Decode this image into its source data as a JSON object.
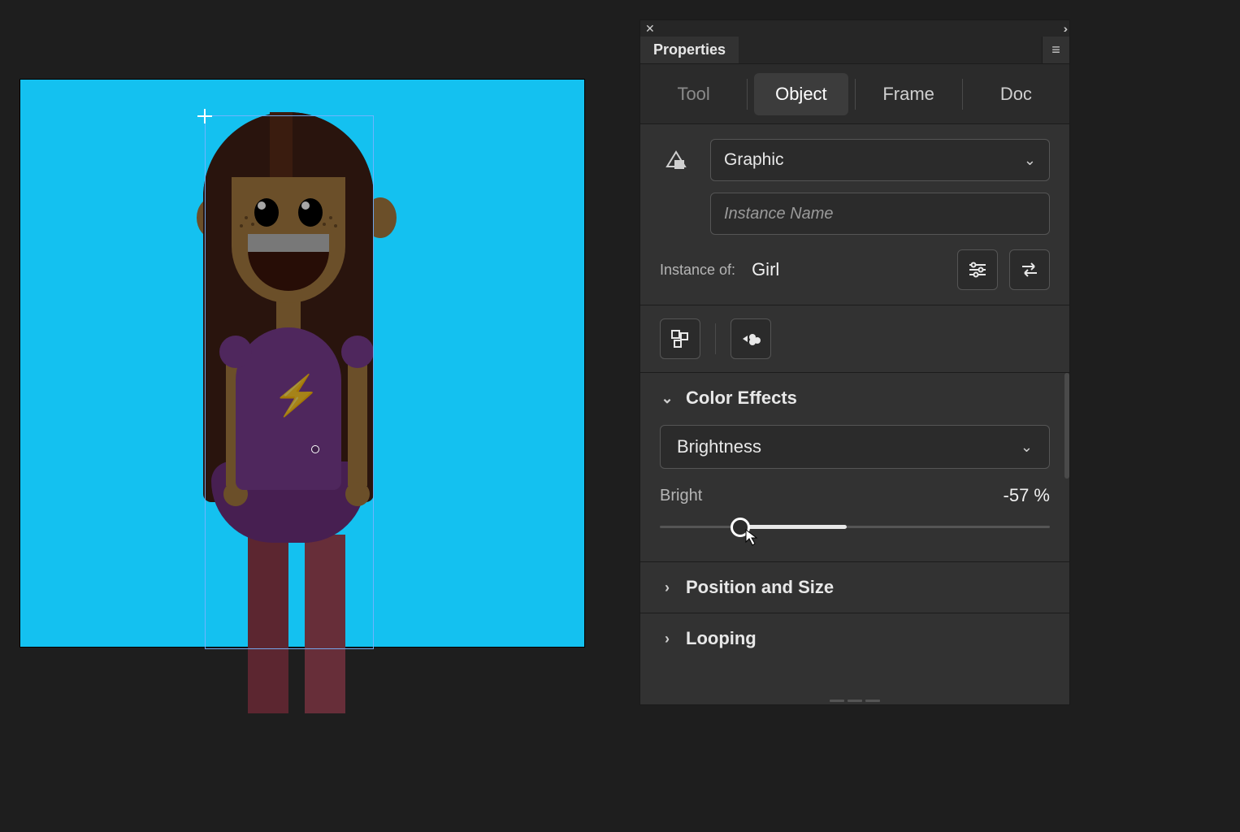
{
  "panel": {
    "title": "Properties",
    "categories": {
      "tool": "Tool",
      "object": "Object",
      "frame": "Frame",
      "doc": "Doc",
      "active": "object"
    },
    "instance": {
      "type_label": "Graphic",
      "name_placeholder": "Instance Name",
      "of_label": "Instance of:",
      "of_value": "Girl"
    },
    "color_effects": {
      "title": "Color Effects",
      "mode": "Brightness",
      "param_label": "Bright",
      "value_display": "-57 %",
      "value_num": -57,
      "min": -100,
      "max": 100
    },
    "sections": {
      "position": "Position and Size",
      "looping": "Looping"
    }
  }
}
